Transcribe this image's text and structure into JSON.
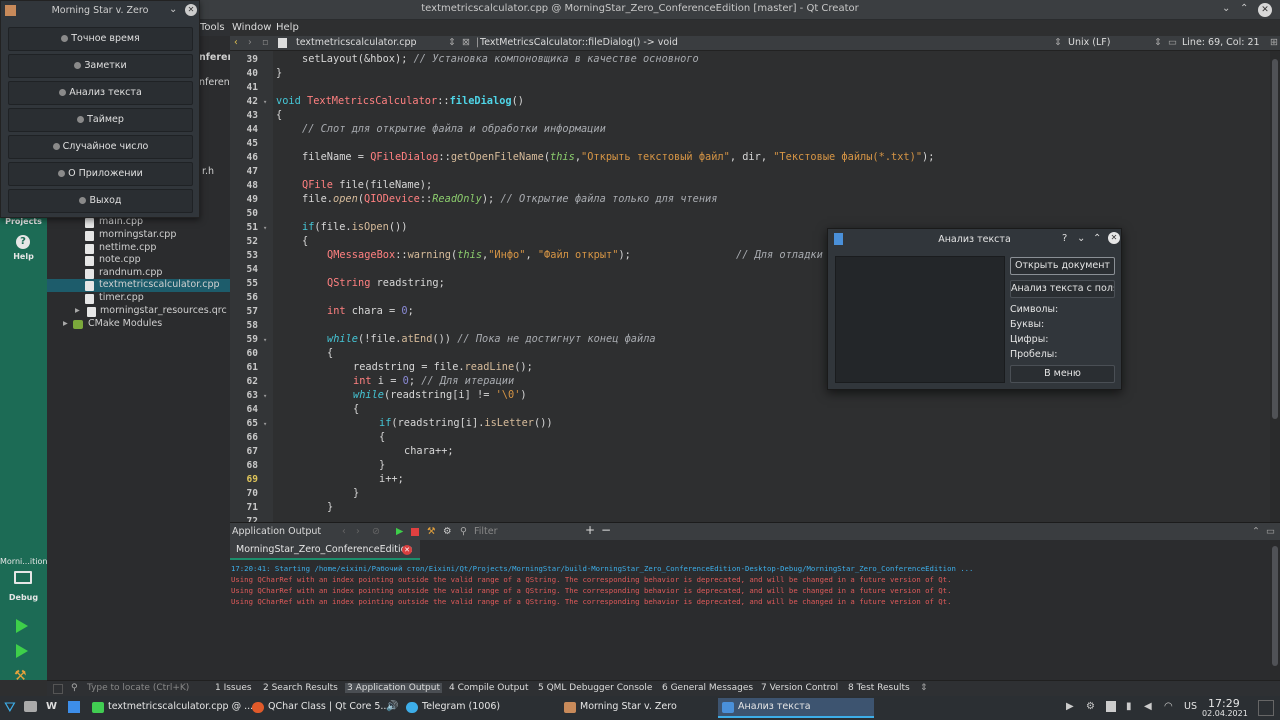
{
  "window": {
    "title": "textmetricscalculator.cpp @ MorningStar_Zero_ConferenceEdition [master] - Qt Creator",
    "controls": [
      "⌄",
      "⌃",
      "✕"
    ]
  },
  "menubar": [
    "Tools",
    "Window",
    "Help"
  ],
  "editor_toolbar": {
    "file": "textmetricscalculator.cpp",
    "symbol": "TextMetricsCalculator::fileDialog() -> void",
    "encoding": "Unix (LF)",
    "position": "Line: 69, Col: 21"
  },
  "modebar": {
    "projects": "Projects",
    "help": "Help",
    "kit_name": "Morni...ition",
    "kit_mode": "Debug"
  },
  "tree": {
    "partial_1": "nferenceE",
    "partial_2": "nferenceEd",
    "partial_3": "r.h",
    "files": [
      "main.cpp",
      "morningstar.cpp",
      "nettime.cpp",
      "note.cpp",
      "randnum.cpp",
      "textmetricscalculator.cpp",
      "timer.cpp"
    ],
    "resources": "morningstar_resources.qrc",
    "cmake": "CMake Modules"
  },
  "editor": {
    "lines": [
      39,
      40,
      41,
      42,
      43,
      44,
      45,
      46,
      47,
      48,
      49,
      50,
      51,
      52,
      53,
      54,
      55,
      56,
      57,
      58,
      59,
      60,
      61,
      62,
      63,
      64,
      65,
      66,
      67,
      68,
      69,
      70,
      71,
      72
    ],
    "current_line": 69,
    "code": {
      "l39a": "setLayout(&hbox); ",
      "l39c": "// Установка компоновщика в качестве основного",
      "l40": "}",
      "l42a": "void ",
      "l42b": "TextMetricsCalculator",
      "l42c": "::",
      "l42d": "fileDialog",
      "l42e": "()",
      "l43": "{",
      "l44": "// Слот для открытие файла и обработки информации",
      "l46a": "fileName = ",
      "l46b": "QFileDialog",
      "l46c": "::",
      "l46d": "getOpenFileName",
      "l46e": "(",
      "l46f": "this",
      "l46g": ",",
      "l46h": "\"Открыть текстовый файл\"",
      "l46i": ", dir, ",
      "l46j": "\"Текстовые файлы(*.txt)\"",
      "l46k": ");",
      "l48a": "QFile",
      "l48b": " file(fileName);",
      "l49a": "file.",
      "l49b": "open",
      "l49c": "(",
      "l49d": "QIODevice",
      "l49e": "::",
      "l49f": "ReadOnly",
      "l49g": "); ",
      "l49h": "// Открытие файла только для чтения",
      "l51a": "if",
      "l51b": "(file.",
      "l51c": "isOpen",
      "l51d": "())",
      "l52": "{",
      "l53a": "QMessageBox",
      "l53b": "::",
      "l53c": "warning",
      "l53d": "(",
      "l53e": "this",
      "l53f": ",",
      "l53g": "\"Инфо\"",
      "l53h": ", ",
      "l53i": "\"Файл открыт\"",
      "l53j": ");",
      "l53k": "// Для отладки",
      "l55a": "QString",
      "l55b": " readstring;",
      "l57a": "int",
      "l57b": " chara = ",
      "l57c": "0",
      "l57d": ";",
      "l59a": "while",
      "l59b": "(!file.",
      "l59c": "atEnd",
      "l59d": "()) ",
      "l59e": "// Пока не достигнут конец файла",
      "l60": "{",
      "l61a": "readstring = file.",
      "l61b": "readLine",
      "l61c": "();",
      "l62a": "int",
      "l62b": " i = ",
      "l62c": "0",
      "l62d": "; ",
      "l62e": "// Для итерации",
      "l63a": "while",
      "l63b": "(readstring[i] != ",
      "l63c": "'\\0'",
      "l63d": ")",
      "l64": "{",
      "l65a": "if",
      "l65b": "(readstring[i].",
      "l65c": "isLetter",
      "l65d": "())",
      "l66": "{",
      "l67": "chara++;",
      "l68": "}",
      "l69": "i++;",
      "l70": "}",
      "l71": "}"
    }
  },
  "output": {
    "header": "Application Output",
    "filter_placeholder": "Filter",
    "tab": "MorningStar_Zero_ConferenceEdition",
    "lines": [
      "17:20:41: Starting /home/eixini/Рабочий стол/Eixini/Qt/Projects/MorningStar/build-MorningStar_Zero_ConferenceEdition-Desktop-Debug/MorningStar_Zero_ConferenceEdition ...",
      "Using QCharRef with an index pointing outside the valid range of a QString. The corresponding behavior is deprecated, and will be changed in a future version of Qt.",
      "Using QCharRef with an index pointing outside the valid range of a QString. The corresponding behavior is deprecated, and will be changed in a future version of Qt.",
      "Using QCharRef with an index pointing outside the valid range of a QString. The corresponding behavior is deprecated, and will be changed in a future version of Qt."
    ]
  },
  "statusbar": {
    "locate_placeholder": "Type to locate (Ctrl+K)",
    "tabs": [
      "1  Issues",
      "2  Search Results",
      "3  Application Output",
      "4  Compile Output",
      "5  QML Debugger Console",
      "6  General Messages",
      "7  Version Control",
      "8  Test Results"
    ]
  },
  "taskbar": {
    "tasks": [
      "textmetricscalculator.cpp @ ...",
      "QChar Class | Qt Core 5....",
      "Telegram (1006)",
      "Morning Star v. Zero",
      "Анализ текста"
    ],
    "lang": "US",
    "time": "17:29",
    "date": "02.04.2021"
  },
  "menu_window": {
    "title": "Morning Star v. Zero",
    "buttons": [
      "Точное время",
      "Заметки",
      "Анализ текста",
      "Таймер",
      "Случайное число",
      "О Приложении",
      "Выход"
    ]
  },
  "dialog": {
    "title": "Анализ текста",
    "controls": [
      "?",
      "⌄",
      "⌃",
      "✕"
    ],
    "open_button": "Открыть документ",
    "analyze_button": "Анализ текста с поля",
    "labels": [
      "Символы:",
      "Буквы:",
      "Цифры:",
      "Пробелы:"
    ],
    "menu_button": "В меню"
  },
  "colors": {
    "accent": "#1c6b55",
    "selection": "#1d5c6b",
    "error_text": "#e05a5a",
    "info_text": "#3daee9"
  }
}
